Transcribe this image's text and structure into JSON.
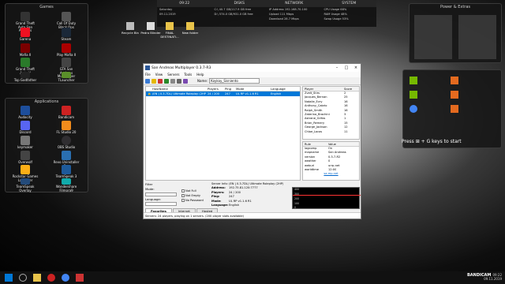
{
  "stats": {
    "headers": [
      "09:22",
      "DISKS",
      "NETWORK",
      "SYSTEM"
    ],
    "time_rows": [
      "Saturday",
      "09.11.2019"
    ],
    "disk_rows": [
      "C:\\   40.7 GB/117.9 GB free",
      "D:\\   574.0 GB/931.0 GB free"
    ],
    "net_rows": [
      "IP Address       192.168.70.100",
      "Upload                  111 Mbps",
      "Download               28.7 Mbps"
    ],
    "sys_rows": [
      "CPU Usage          68%",
      "RAM Usage          48%",
      "Swap Usage         53%"
    ]
  },
  "fence_games": {
    "title": "Games",
    "items": [
      "Grand Theft Auto San Andreas",
      "Call Of Duty Black Ops",
      "Garena",
      "Steam",
      "Mafia II",
      "Play Mafia II",
      "Grand Theft Auto V",
      "GTA San Andreas Multiplayer",
      "Top Godfather",
      "TLauncher"
    ]
  },
  "fence_apps": {
    "title": "Applications",
    "items": [
      "Audacity",
      "Bandicam",
      "Discord",
      "FL Studio 20",
      "keymaker",
      "OBS Studio",
      "Overwolf",
      "Revo Uninstaller Pro",
      "Rockstar Games Launcher",
      "TeamSpeak 3 Client",
      "TeamSpeak Overlay",
      "Wondershare Filmora9"
    ]
  },
  "desktop_icons": [
    "Recycle Bin",
    "Pedro Blinder",
    "FINAL DESTINATI...",
    "New folder"
  ],
  "window": {
    "title": "San Andreas Multiplayer 0.3.7-R3",
    "menu": [
      "File",
      "View",
      "Servers",
      "Tools",
      "Help"
    ],
    "name_label": "Name:",
    "name_value": "Koykoy_Sisniento",
    "server_headers": [
      "",
      "HostName",
      "Players",
      "Ping",
      "Mode",
      "Language"
    ],
    "server_row": [
      "🔒",
      "(EN | 0.3.7DL) Ultimate Roleplay (2HP)",
      "24 / 200",
      "247",
      "UL RP v1.1.6 R1",
      "English"
    ],
    "player_headers": [
      "Player",
      "Score"
    ],
    "players": [
      [
        "Zvelt_Stirs",
        "2"
      ],
      [
        "Jacques_Bernan",
        "25"
      ],
      [
        "Natalie_Evry",
        "16"
      ],
      [
        "Anthony_Cabrio",
        "16"
      ],
      [
        "Ralph_Smith",
        "16"
      ],
      [
        "Zaterina_Brachini",
        "3"
      ],
      [
        "Astrane_Grifos",
        "1"
      ],
      [
        "Brian_Remery",
        "15"
      ],
      [
        "George_Jackson",
        "12"
      ],
      [
        "Chloe_Locos",
        "11"
      ]
    ],
    "rule_headers": [
      "Rule",
      "Value"
    ],
    "rules": [
      [
        "lagcomp",
        "On"
      ],
      [
        "mapname",
        "San Andreas"
      ],
      [
        "version",
        "0.3.7-R2"
      ],
      [
        "weather",
        "0"
      ],
      [
        "weburl",
        "urrp.net"
      ],
      [
        "worldtime",
        "12:00"
      ]
    ],
    "rules_link": "sa-mp.net",
    "filter_label": "Filter",
    "mode_label": "Mode:",
    "language_label": "Language:",
    "checkboxes": [
      "Not Full",
      "Not Empty",
      "No Password"
    ],
    "server_info_title": "Server Info: (EN | 0.3.7DL) Ultimate Roleplay (2HP)",
    "server_info": [
      [
        "Address:",
        "192.75.81.120:7777"
      ],
      [
        "Players:",
        "24 / 200"
      ],
      [
        "Ping:",
        "247"
      ],
      [
        "Mode:",
        "UL RP v1.1.6 R1"
      ],
      [
        "Language:",
        "English"
      ]
    ],
    "ping_axis": [
      "400",
      "300",
      "200",
      "100",
      "0"
    ],
    "tabs": [
      "Favorites",
      "Internet",
      "Hosted"
    ],
    "status": "Servers: 24 players, playing on 1 servers. (200 player slots available)"
  },
  "right_panel": {
    "title_top": "Power & Extras",
    "hint": "Press ⊞ + G keys to start",
    "items": [
      "GeForce Experience",
      "NVIDIA Control Panel",
      "Photoshop",
      "Premiere Pro",
      "Chrome",
      "Xbox Game Bar"
    ]
  },
  "tray": {
    "time": "09:22",
    "date": "09.11.2019"
  },
  "watermark": "BANDICAM"
}
